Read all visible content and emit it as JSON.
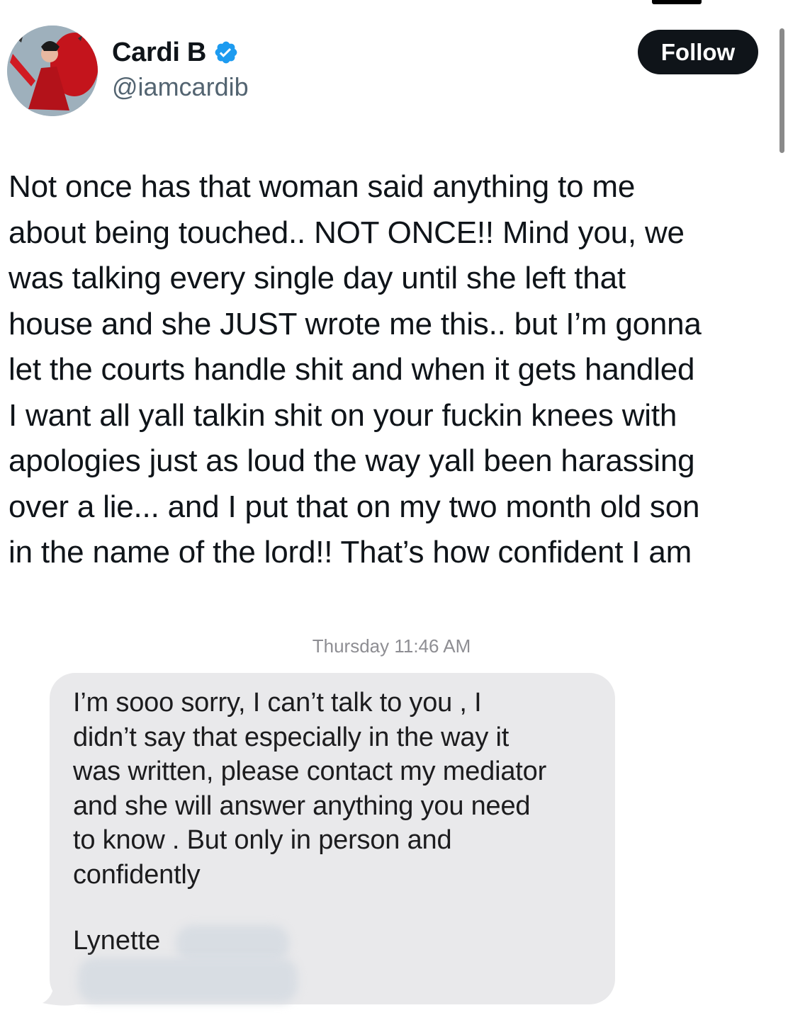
{
  "author": {
    "display_name": "Cardi B",
    "handle": "@iamcardib",
    "verified": true,
    "avatar_icon": "profile-photo"
  },
  "header": {
    "follow_label": "Follow"
  },
  "tweet": {
    "text": "Not once has that woman said anything to me\nabout being touched.. NOT ONCE!! Mind you, we\nwas talking every single day until she left that\nhouse and she JUST wrote me this.. but I’m gonna\nlet the courts handle shit and when it gets handled\nI want all yall talkin shit on your fuckin knees with\napologies just as loud the way yall been harassing\nover a lie... and I put that on my two month old son\nin the name of the lord!! That’s how confident I am"
  },
  "attached_image": {
    "timestamp": "Thursday 11:46 AM",
    "message_text": "I’m sooo sorry, I can’t talk to you , I\ndidn’t say that especially in the way it\nwas written, please contact my mediator\nand she will answer anything you need\nto know . But only in person and\nconfidently",
    "signature": "Lynette"
  },
  "colors": {
    "text_primary": "#0f1419",
    "text_secondary": "#536471",
    "verified_blue": "#1d9bf0",
    "follow_bg": "#0f1419",
    "bubble_bg": "#e9e9eb",
    "timestamp_gray": "#8e8e93"
  }
}
